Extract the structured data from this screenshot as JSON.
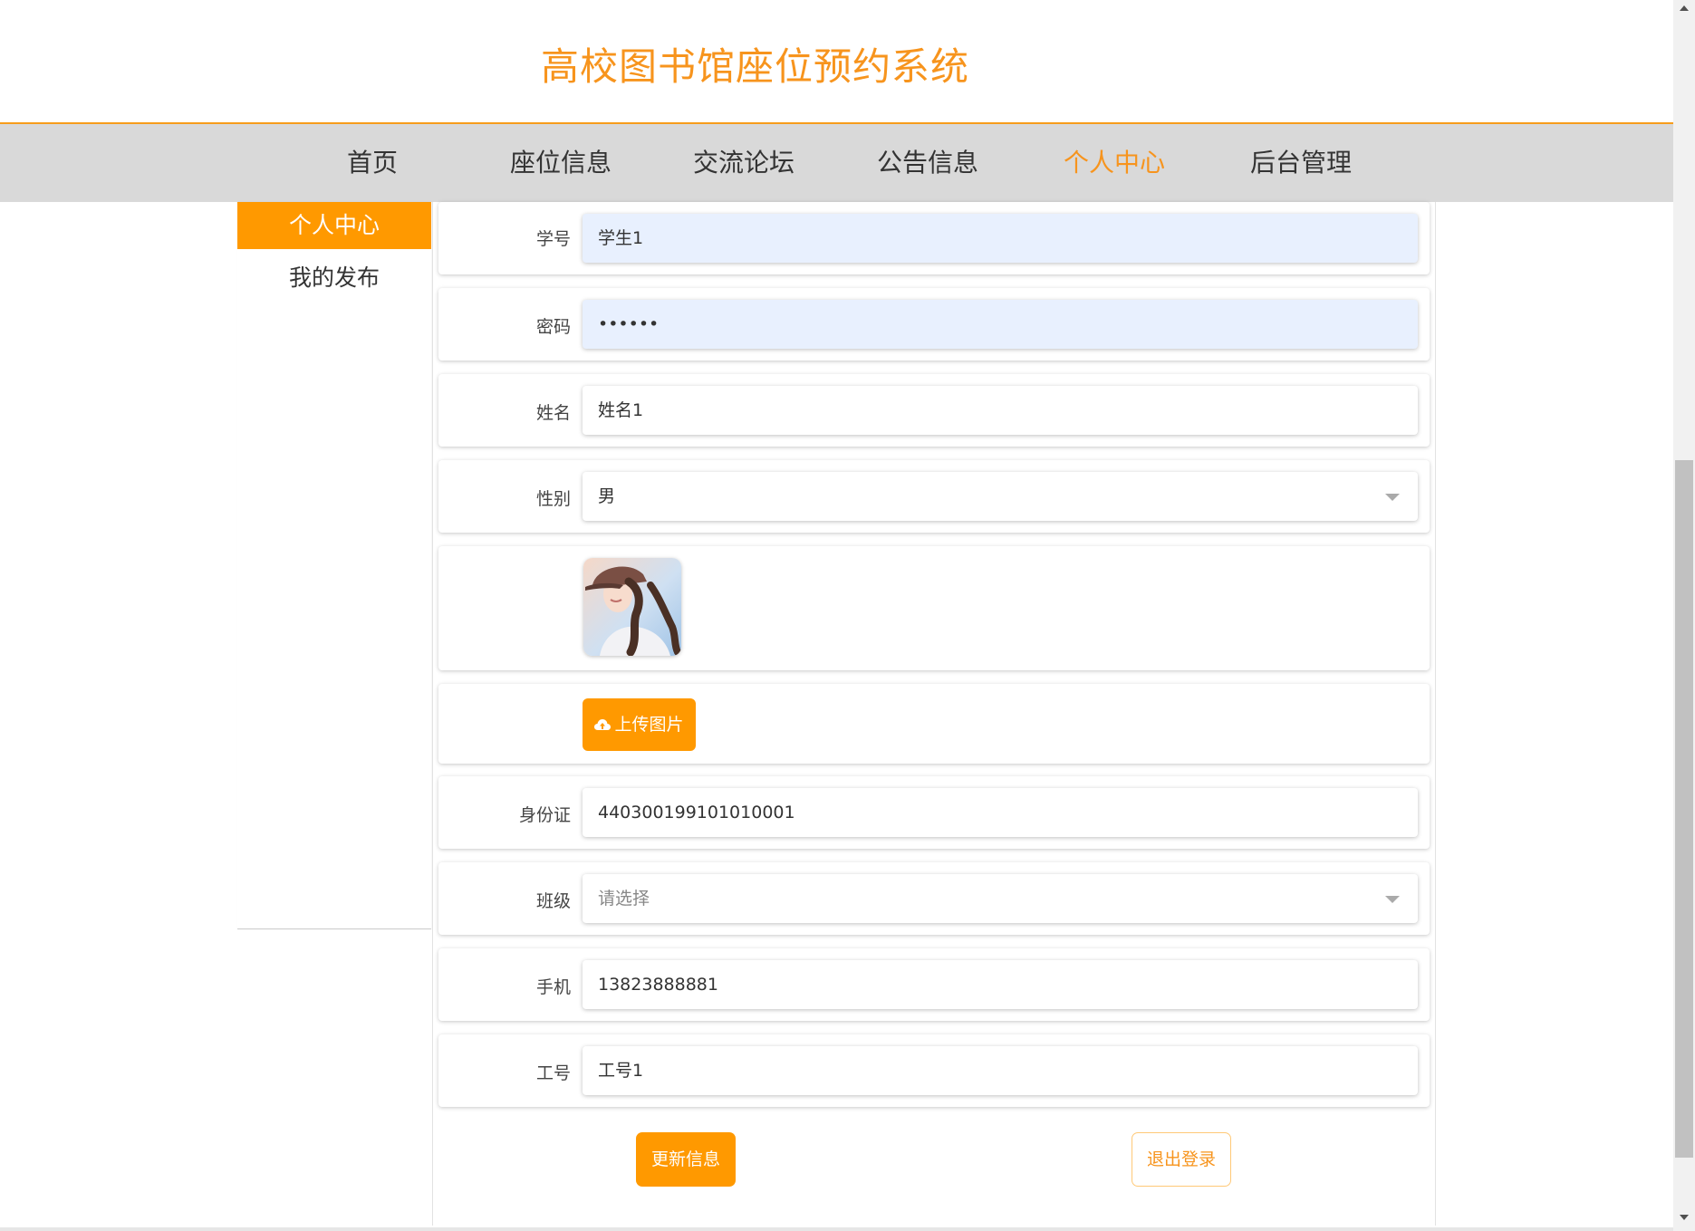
{
  "site": {
    "title": "高校图书馆座位预约系统"
  },
  "nav": {
    "items": [
      {
        "label": "首页"
      },
      {
        "label": "座位信息"
      },
      {
        "label": "交流论坛"
      },
      {
        "label": "公告信息"
      },
      {
        "label": "个人中心"
      },
      {
        "label": "后台管理"
      }
    ],
    "active": "个人中心"
  },
  "sidebar": {
    "items": [
      {
        "label": "个人中心"
      },
      {
        "label": "我的发布"
      }
    ]
  },
  "form": {
    "student_id": {
      "label": "学号",
      "value": "学生1"
    },
    "password": {
      "label": "密码",
      "value": "••••••"
    },
    "name": {
      "label": "姓名",
      "value": "姓名1"
    },
    "gender": {
      "label": "性别",
      "value": "男"
    },
    "upload_label": "上传图片",
    "id_card": {
      "label": "身份证",
      "value": "440300199101010001"
    },
    "class": {
      "label": "班级",
      "placeholder": "请选择"
    },
    "phone": {
      "label": "手机",
      "value": "13823888881"
    },
    "work_id": {
      "label": "工号",
      "value": "工号1"
    }
  },
  "actions": {
    "update_label": "更新信息",
    "logout_label": "退出登录"
  },
  "colors": {
    "accent": "#ff9900",
    "title": "#f7941d",
    "nav_bg": "#d9d9d9",
    "autofill": "#e8f0fe"
  }
}
